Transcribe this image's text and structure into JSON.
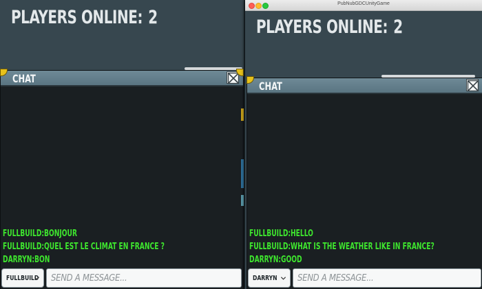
{
  "window": {
    "title": "PubNubGDCUnityGame"
  },
  "left": {
    "players_label": "PLAYERS ONLINE:",
    "players_count": "2",
    "chat_title": "CHAT",
    "messages": [
      "FULLBUILD:BONJOUR",
      "FULLBUILD:QUEL EST LE CLIMAT EN FRANCE ?",
      "DARRYN:BON"
    ],
    "user_select": "FULLBUILD",
    "input_placeholder": "SEND A MESSAGE..."
  },
  "right": {
    "players_label": "PLAYERS ONLINE:",
    "players_count": "2",
    "chat_title": "CHAT",
    "messages": [
      "FULLBUILD:HELLO",
      "FULLBUILD:WHAT IS THE WEATHER LIKE IN FRANCE?",
      "DARRYN:GOOD"
    ],
    "user_select": "DARRYN",
    "input_placeholder": "SEND A MESSAGE..."
  },
  "colors": {
    "background": "#37474f",
    "chat_bg": "#1a1f22",
    "header": "#5f7a87",
    "message": "#3ee62e",
    "corner": "#e8c21b"
  },
  "icons": {
    "close": "close-x-box-icon",
    "dropdown": "chevron-down-icon",
    "window_controls": [
      "close-window-icon",
      "minimize-window-icon",
      "maximize-window-icon"
    ]
  }
}
